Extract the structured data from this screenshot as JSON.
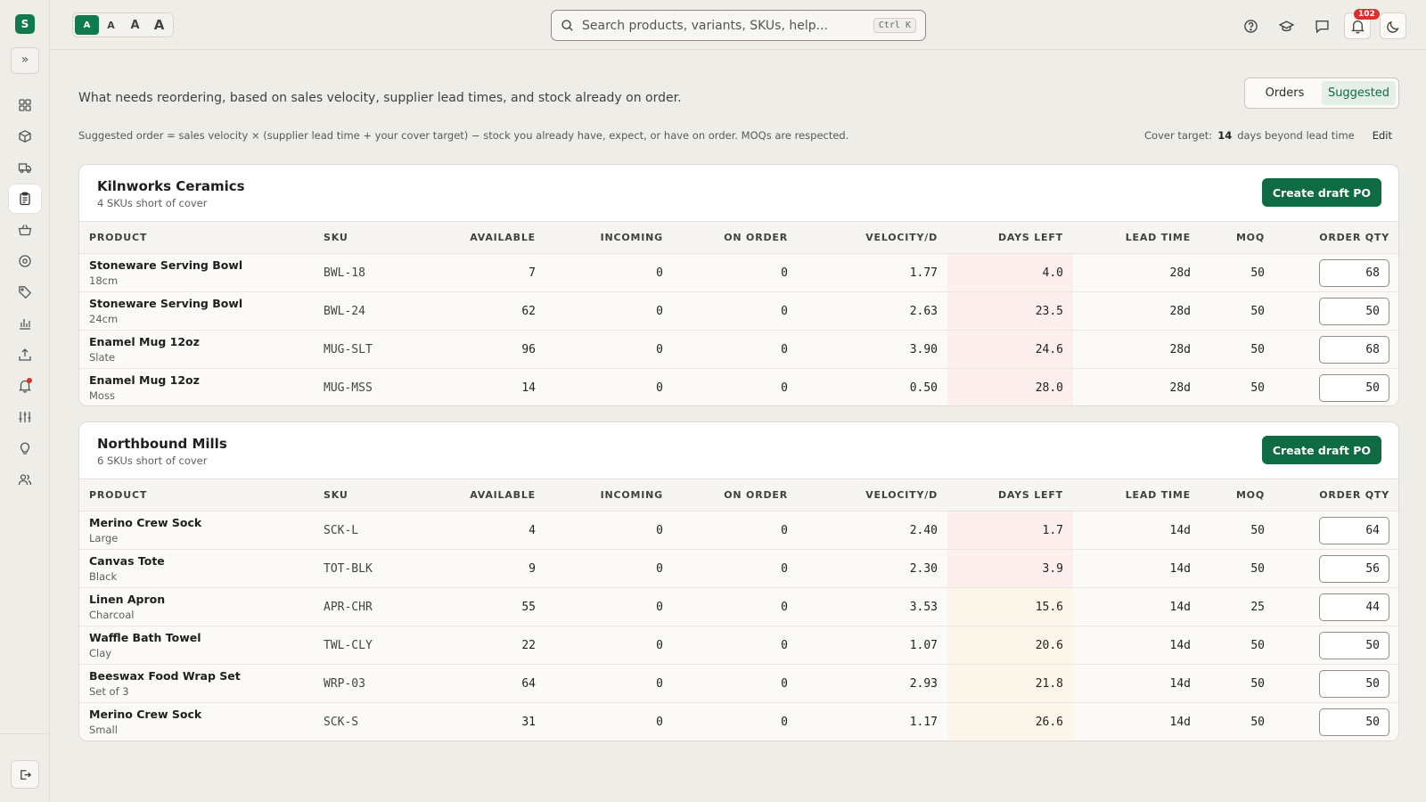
{
  "app": {
    "logo_letter": "S"
  },
  "sidebar": {
    "expand_glyph": "»",
    "items": [
      {
        "name": "dashboard",
        "icon": "grid-icon"
      },
      {
        "name": "products",
        "icon": "box-icon"
      },
      {
        "name": "shipping",
        "icon": "truck-icon"
      },
      {
        "name": "reorder",
        "icon": "clipboard-icon",
        "active": true
      },
      {
        "name": "orders",
        "icon": "basket-icon"
      },
      {
        "name": "locations",
        "icon": "target-icon"
      },
      {
        "name": "tags",
        "icon": "tag-icon"
      },
      {
        "name": "reports",
        "icon": "chart-icon"
      },
      {
        "name": "export",
        "icon": "upload-icon"
      },
      {
        "name": "alerts",
        "icon": "bell-icon",
        "dot": true
      },
      {
        "name": "settings",
        "icon": "sliders-icon"
      },
      {
        "name": "tips",
        "icon": "lightbulb-icon"
      },
      {
        "name": "team",
        "icon": "users-icon"
      }
    ]
  },
  "topbar": {
    "font_sizes": [
      "A",
      "A",
      "A",
      "A"
    ],
    "search": {
      "placeholder": "Search products, variants, SKUs, help...",
      "shortcut": "Ctrl K"
    },
    "notification_count": "102"
  },
  "page": {
    "intro": "What needs reordering, based on sales velocity, supplier lead times, and stock already on order.",
    "tabs": {
      "orders": "Orders",
      "suggested": "Suggested"
    },
    "formula": "Suggested order = sales velocity × (supplier lead time + your cover target) − stock you already have, expect, or have on order. MOQs are respected.",
    "cover": {
      "label": "Cover target:",
      "value": "14",
      "suffix": "days beyond lead time",
      "edit": "Edit"
    }
  },
  "columns": {
    "product": "PRODUCT",
    "sku": "SKU",
    "available": "AVAILABLE",
    "incoming": "INCOMING",
    "on_order": "ON ORDER",
    "velocity": "VELOCITY/D",
    "days_left": "DAYS LEFT",
    "lead_time": "LEAD TIME",
    "moq": "MOQ",
    "order_qty": "ORDER QTY"
  },
  "suppliers": [
    {
      "name": "Kilnworks Ceramics",
      "sub": "4 SKUs short of cover",
      "button": "Create draft PO",
      "rows": [
        {
          "product": "Stoneware Serving Bowl",
          "variant": "18cm",
          "sku": "BWL-18",
          "available": "7",
          "incoming": "0",
          "on_order": "0",
          "velocity": "1.77",
          "days_left": "4.0",
          "lead": "28d",
          "moq": "50",
          "qty": "68",
          "status": "critical"
        },
        {
          "product": "Stoneware Serving Bowl",
          "variant": "24cm",
          "sku": "BWL-24",
          "available": "62",
          "incoming": "0",
          "on_order": "0",
          "velocity": "2.63",
          "days_left": "23.5",
          "lead": "28d",
          "moq": "50",
          "qty": "50",
          "status": "critical"
        },
        {
          "product": "Enamel Mug 12oz",
          "variant": "Slate",
          "sku": "MUG-SLT",
          "available": "96",
          "incoming": "0",
          "on_order": "0",
          "velocity": "3.90",
          "days_left": "24.6",
          "lead": "28d",
          "moq": "50",
          "qty": "68",
          "status": "critical"
        },
        {
          "product": "Enamel Mug 12oz",
          "variant": "Moss",
          "sku": "MUG-MSS",
          "available": "14",
          "incoming": "0",
          "on_order": "0",
          "velocity": "0.50",
          "days_left": "28.0",
          "lead": "28d",
          "moq": "50",
          "qty": "50",
          "status": "critical"
        }
      ]
    },
    {
      "name": "Northbound Mills",
      "sub": "6 SKUs short of cover",
      "button": "Create draft PO",
      "rows": [
        {
          "product": "Merino Crew Sock",
          "variant": "Large",
          "sku": "SCK-L",
          "available": "4",
          "incoming": "0",
          "on_order": "0",
          "velocity": "2.40",
          "days_left": "1.7",
          "lead": "14d",
          "moq": "50",
          "qty": "64",
          "status": "critical"
        },
        {
          "product": "Canvas Tote",
          "variant": "Black",
          "sku": "TOT-BLK",
          "available": "9",
          "incoming": "0",
          "on_order": "0",
          "velocity": "2.30",
          "days_left": "3.9",
          "lead": "14d",
          "moq": "50",
          "qty": "56",
          "status": "critical"
        },
        {
          "product": "Linen Apron",
          "variant": "Charcoal",
          "sku": "APR-CHR",
          "available": "55",
          "incoming": "0",
          "on_order": "0",
          "velocity": "3.53",
          "days_left": "15.6",
          "lead": "14d",
          "moq": "25",
          "qty": "44",
          "status": "warn"
        },
        {
          "product": "Waffle Bath Towel",
          "variant": "Clay",
          "sku": "TWL-CLY",
          "available": "22",
          "incoming": "0",
          "on_order": "0",
          "velocity": "1.07",
          "days_left": "20.6",
          "lead": "14d",
          "moq": "50",
          "qty": "50",
          "status": "warn"
        },
        {
          "product": "Beeswax Food Wrap Set",
          "variant": "Set of 3",
          "sku": "WRP-03",
          "available": "64",
          "incoming": "0",
          "on_order": "0",
          "velocity": "2.93",
          "days_left": "21.8",
          "lead": "14d",
          "moq": "50",
          "qty": "50",
          "status": "warn"
        },
        {
          "product": "Merino Crew Sock",
          "variant": "Small",
          "sku": "SCK-S",
          "available": "31",
          "incoming": "0",
          "on_order": "0",
          "velocity": "1.17",
          "days_left": "26.6",
          "lead": "14d",
          "moq": "50",
          "qty": "50",
          "status": "warn"
        }
      ]
    }
  ]
}
